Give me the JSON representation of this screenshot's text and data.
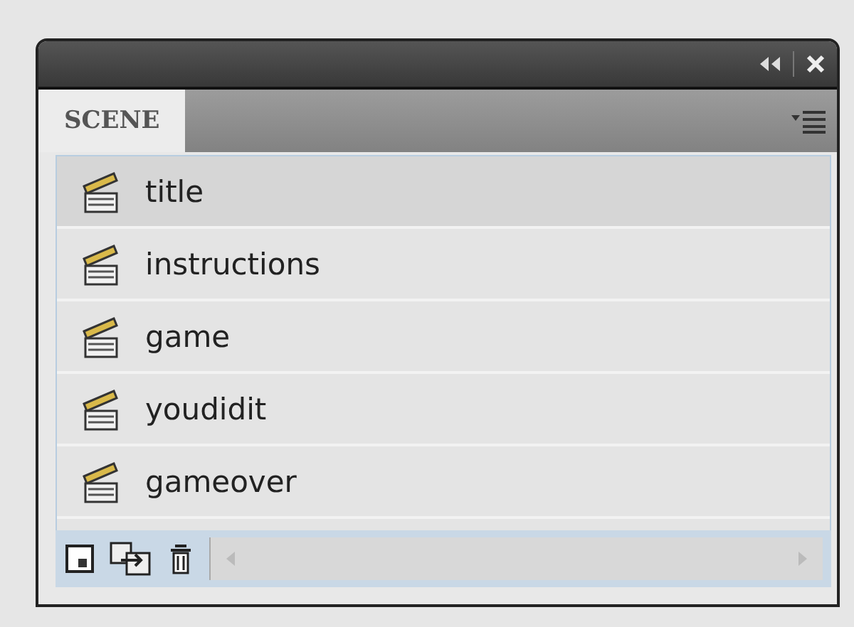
{
  "panel": {
    "tab": {
      "label": "SCENE",
      "selected": true
    }
  },
  "scenes": [
    {
      "name": "title",
      "selected": true
    },
    {
      "name": "instructions",
      "selected": false
    },
    {
      "name": "game",
      "selected": false
    },
    {
      "name": "youdidit",
      "selected": false
    },
    {
      "name": "gameover",
      "selected": false
    }
  ]
}
